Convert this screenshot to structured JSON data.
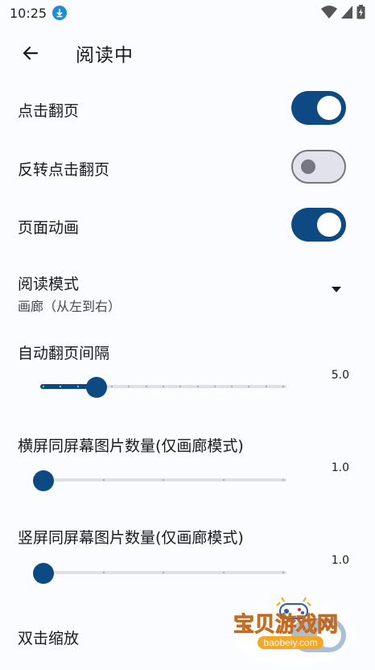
{
  "status_bar": {
    "time": "10:25"
  },
  "app_bar": {
    "title": "阅读中"
  },
  "settings": {
    "tap_to_turn": {
      "label": "点击翻页",
      "enabled": true
    },
    "reverse_tap": {
      "label": "反转点击翻页",
      "enabled": false
    },
    "page_animation": {
      "label": "页面动画",
      "enabled": true
    },
    "reading_mode": {
      "label": "阅读模式",
      "value": "画廊（从左到右）"
    },
    "auto_turn_interval": {
      "label": "自动翻页间隔",
      "value": "5.0",
      "level": 0.22
    },
    "landscape_images": {
      "label": "横屏同屏幕图片数量(仅画廊模式)",
      "value": "1.0",
      "level": 0.0
    },
    "portrait_images": {
      "label": "竖屏同屏幕图片数量(仅画廊模式)",
      "value": "1.0",
      "level": 0.0
    },
    "double_tap_zoom": {
      "label": "双击缩放",
      "enabled": true
    }
  },
  "watermark": {
    "text": "宝贝游戏网",
    "url": "baobeiy.com"
  },
  "colors": {
    "accent": "#0d4a83",
    "track": "#dde0e8"
  }
}
